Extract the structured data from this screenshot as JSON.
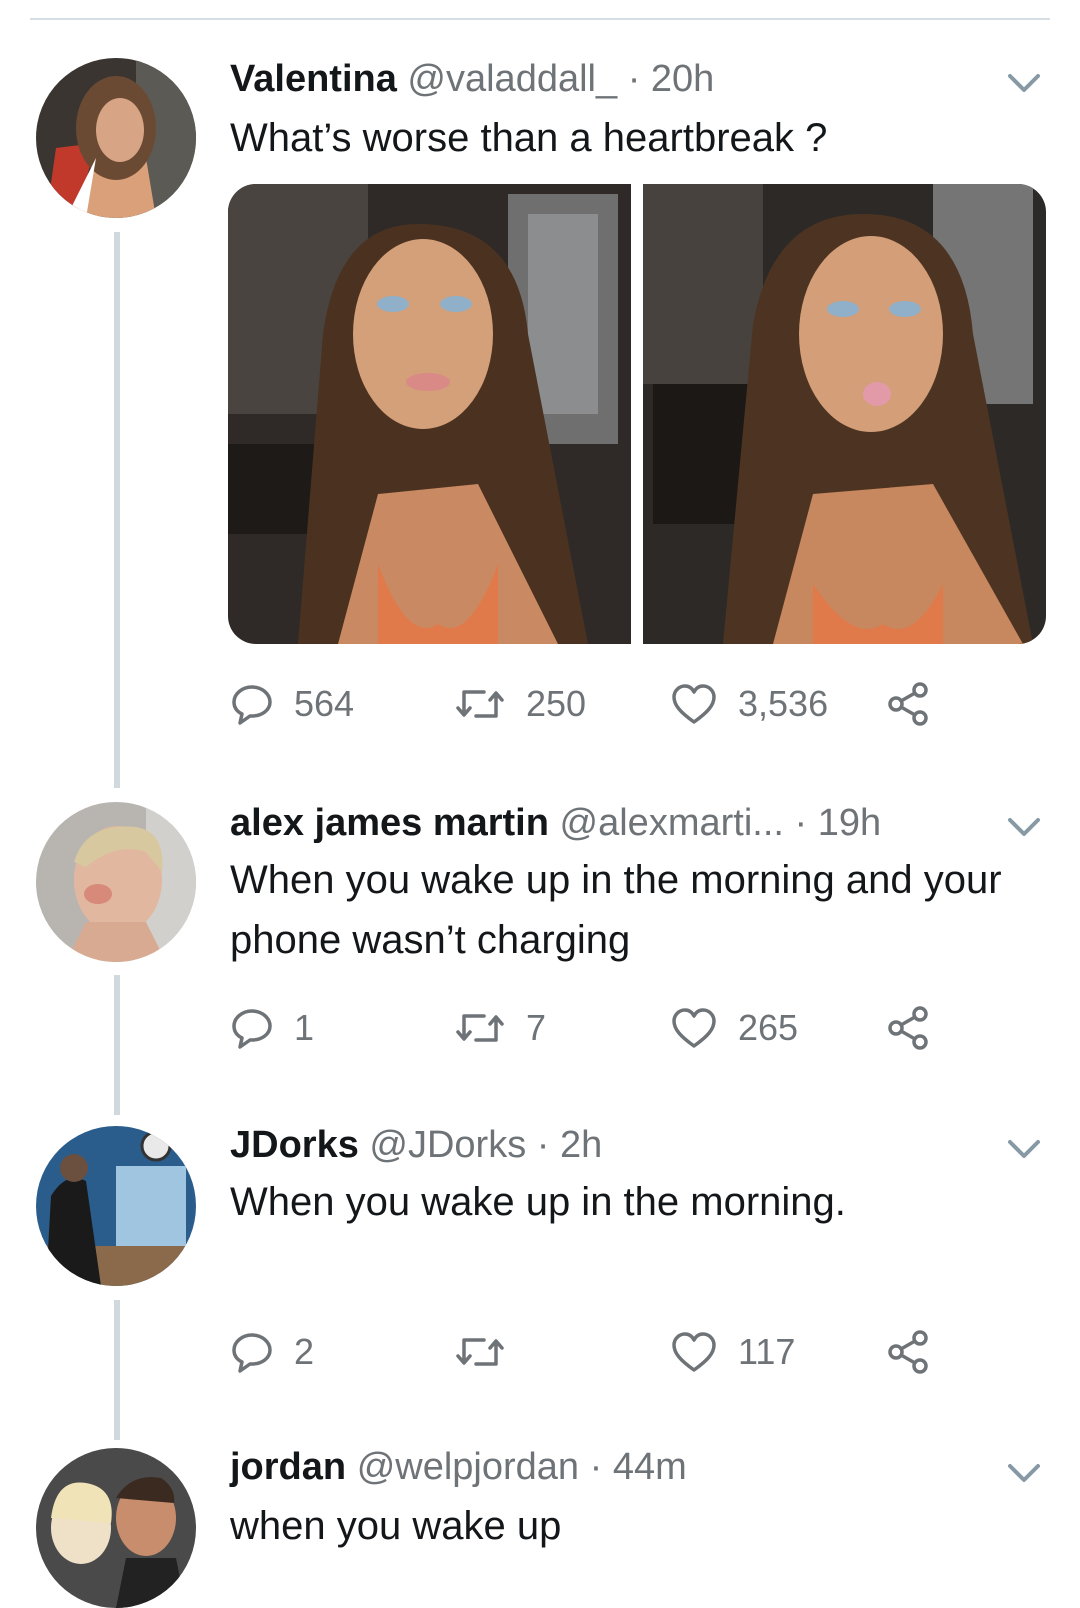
{
  "tweets": [
    {
      "name": "Valentina",
      "handle": "@valaddall_",
      "separator": "·",
      "time": "20h",
      "text": "What’s worse than a heartbreak ?",
      "replies": "564",
      "retweets": "250",
      "likes": "3,536"
    },
    {
      "name": "alex james martin",
      "handle": "@alexmarti...",
      "separator": "·",
      "time": "19h",
      "text": "When you wake up in the morning and your phone wasn’t charging",
      "replies": "1",
      "retweets": "7",
      "likes": "265"
    },
    {
      "name": "JDorks",
      "handle": "@JDorks",
      "separator": "·",
      "time": "2h",
      "text": "When you wake up in the morning.",
      "replies": "2",
      "retweets": "",
      "likes": "117"
    },
    {
      "name": "jordan",
      "handle": "@welpjordan",
      "separator": "·",
      "time": "44m",
      "text": "when you wake up"
    }
  ],
  "icons": {
    "reply": "reply-icon",
    "retweet": "retweet-icon",
    "like": "heart-icon",
    "share": "share-icon",
    "menu": "chevron-down-icon"
  },
  "colors": {
    "icon_gray": "#6e7378",
    "thread_line": "#cfd9de"
  }
}
